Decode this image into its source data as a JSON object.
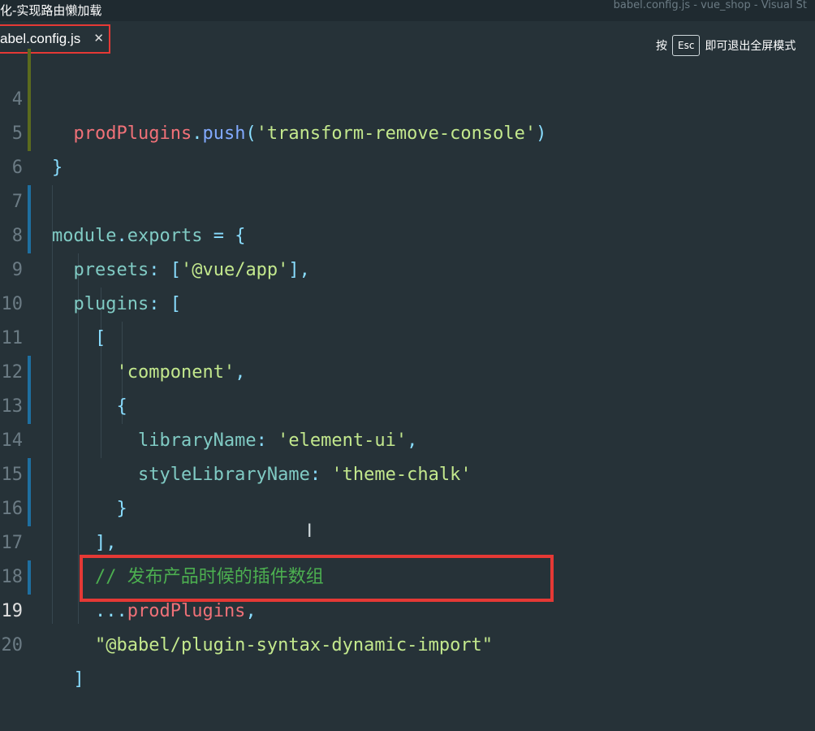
{
  "titlebar": {
    "left": "化-实现路由懒加载",
    "right": "babel.config.js - vue_shop - Visual St"
  },
  "tab": {
    "name": "abel.config.js",
    "close": "✕"
  },
  "esc_hint": {
    "before": "按",
    "key": "Esc",
    "after": "即可退出全屏模式"
  },
  "lines": [
    {
      "n": "4",
      "code": "  prodPlugins.push('transform-remove-console')"
    },
    {
      "n": "5",
      "code": "}"
    },
    {
      "n": "6",
      "code": ""
    },
    {
      "n": "7",
      "code": "module.exports = {"
    },
    {
      "n": "8",
      "code": "  presets: ['@vue/app'],"
    },
    {
      "n": "9",
      "code": "  plugins: ["
    },
    {
      "n": "10",
      "code": "    ["
    },
    {
      "n": "11",
      "code": "      'component',"
    },
    {
      "n": "12",
      "code": "      {"
    },
    {
      "n": "13",
      "code": "        libraryName: 'element-ui',"
    },
    {
      "n": "14",
      "code": "        styleLibraryName: 'theme-chalk'"
    },
    {
      "n": "15",
      "code": "      }"
    },
    {
      "n": "16",
      "code": "    ],"
    },
    {
      "n": "17",
      "code": "    // 发布产品时候的插件数组"
    },
    {
      "n": "18",
      "code": "    ...prodPlugins,"
    },
    {
      "n": "19",
      "code": "    \"@babel/plugin-syntax-dynamic-import\""
    },
    {
      "n": "20",
      "code": "  ]"
    }
  ]
}
